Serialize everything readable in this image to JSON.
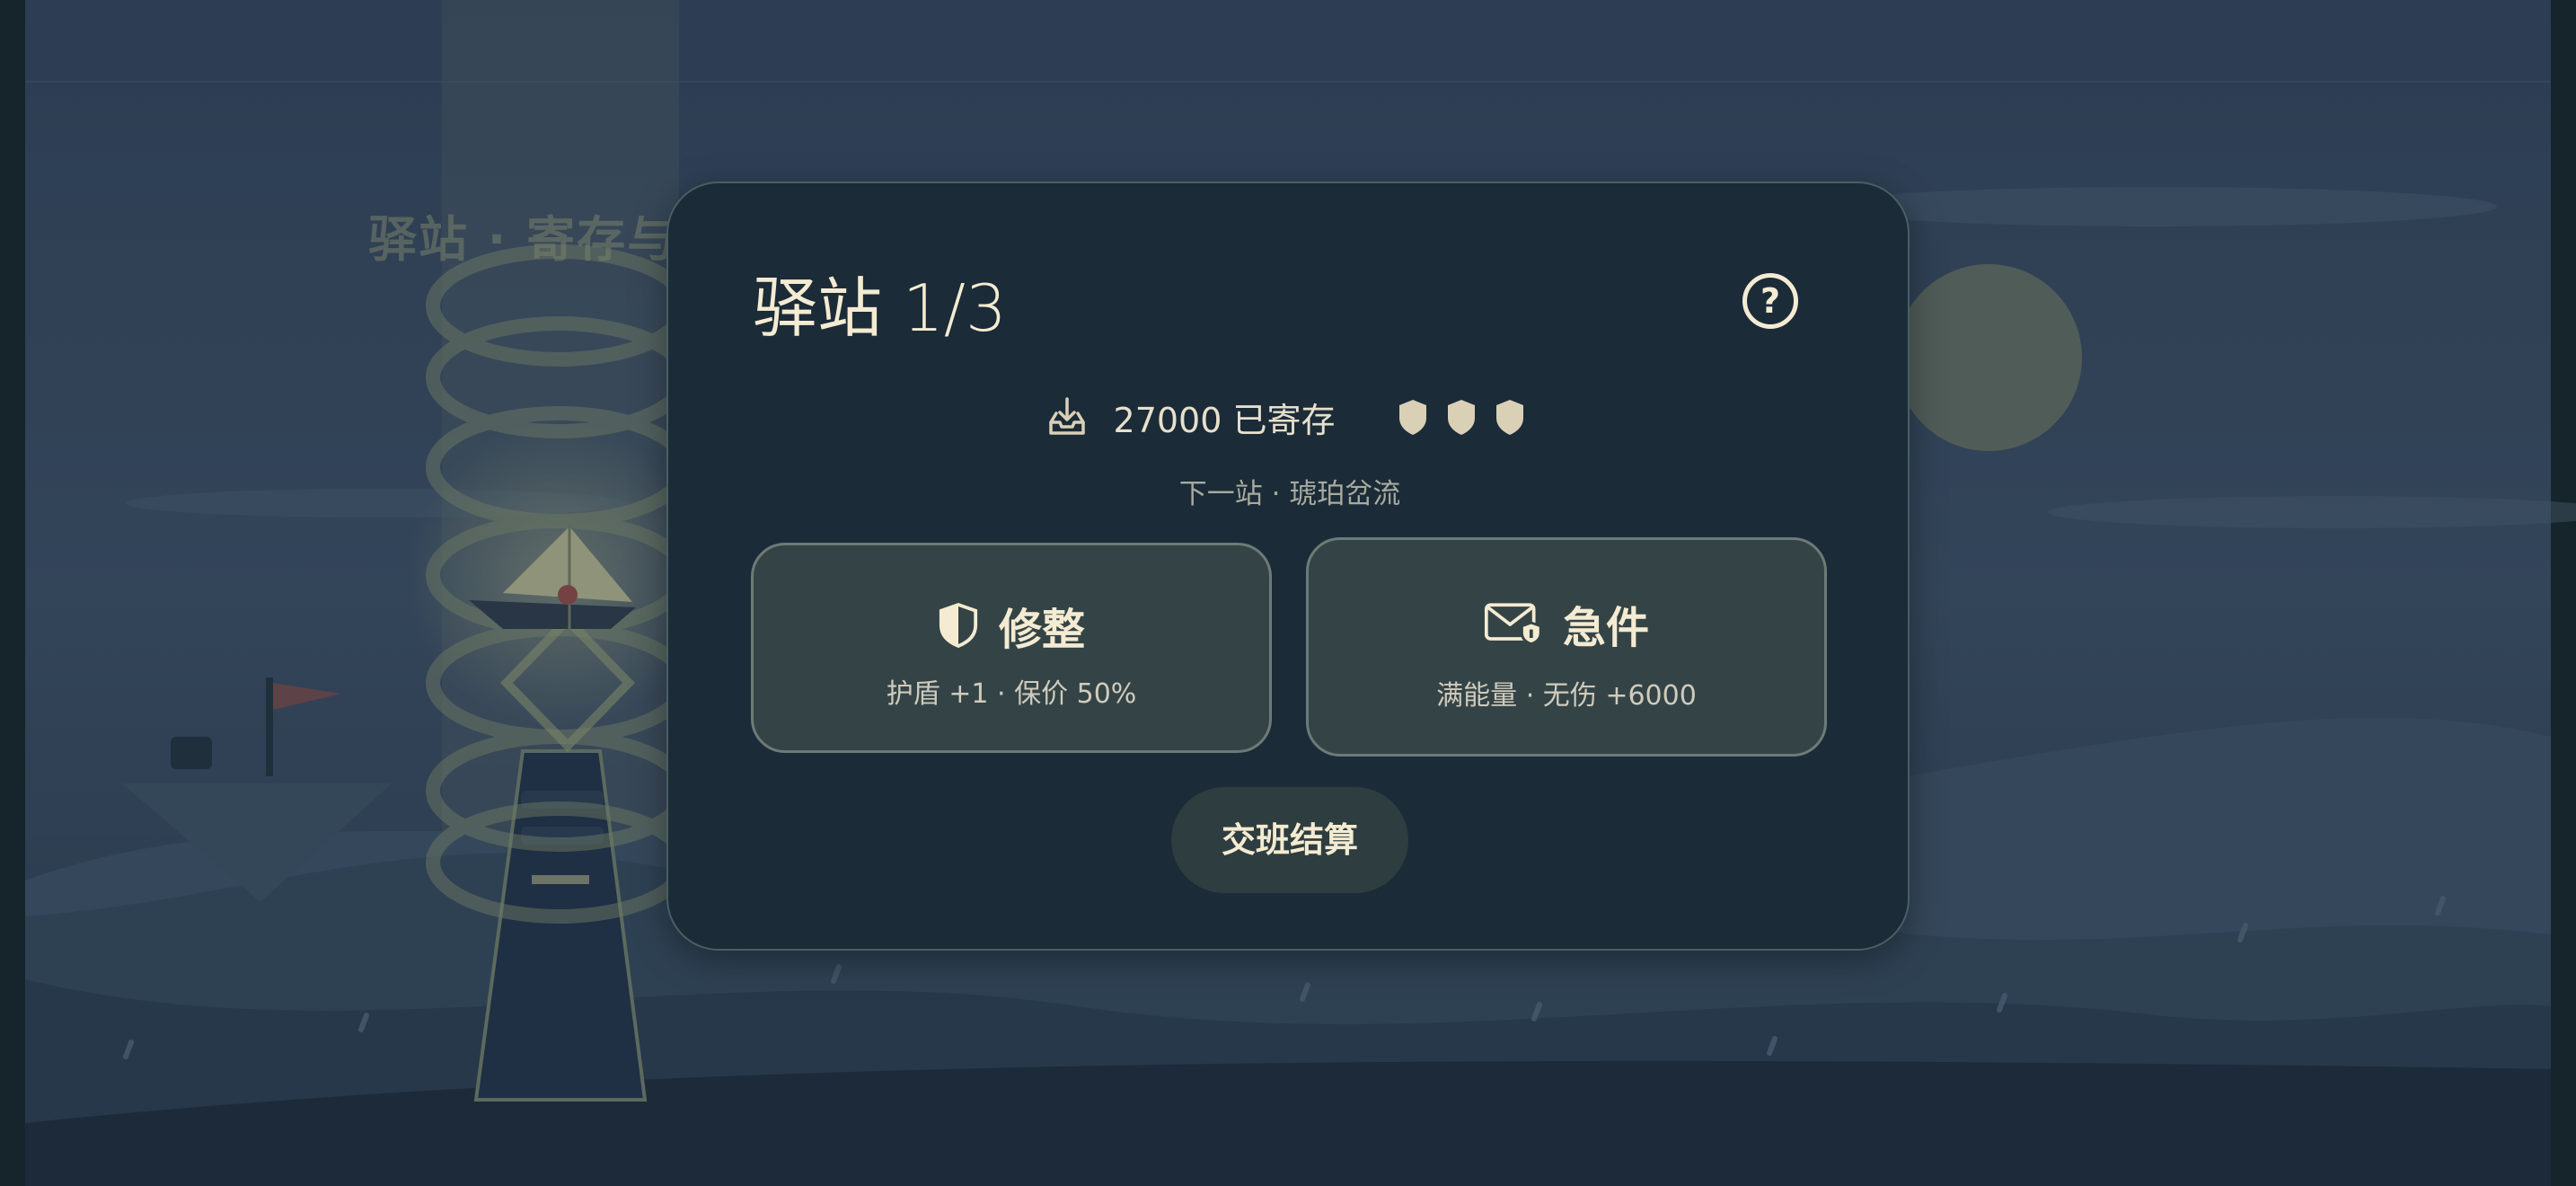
{
  "background": {
    "title": "驿站 · 寄存与补"
  },
  "modal": {
    "title": "驿站 1/3",
    "help_label": "?",
    "stored_text": "27000 已寄存",
    "shield_count": 3,
    "next_stop": "下一站 · 琥珀岔流",
    "actions": [
      {
        "label": "修整",
        "desc": "护盾 +1 · 保价 50%",
        "icon": "shield-half-icon"
      },
      {
        "label": "急件",
        "desc": "满能量 · 无伤 +6000",
        "icon": "mail-shield-icon"
      }
    ],
    "settle_label": "交班结算"
  },
  "colors": {
    "modal_bg": "#1b2b38",
    "card_bg": "#344446",
    "text_primary": "#f4ebd2",
    "shield_fill": "#d9d0b6"
  }
}
